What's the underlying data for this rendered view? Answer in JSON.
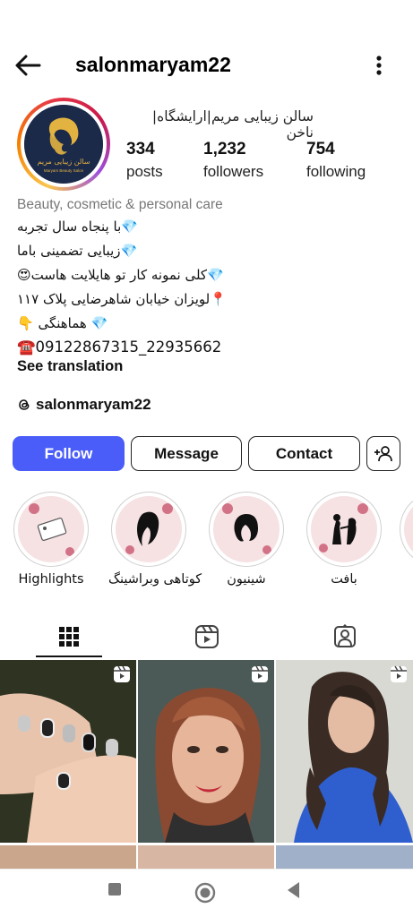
{
  "header": {
    "username": "salonmaryam22",
    "back_icon": "arrow-left-icon",
    "more_icon": "more-vertical-icon"
  },
  "profile": {
    "display_name": "سالن زیبایی مریم|ارایشگاه|ناخن",
    "avatar_text": "سالن زیبایی مریم",
    "avatar_subtext": "Maryam Beauty Salon",
    "stats": [
      {
        "value": "334",
        "label": "posts"
      },
      {
        "value": "1,232",
        "label": "followers"
      },
      {
        "value": "754",
        "label": "following"
      }
    ]
  },
  "bio": {
    "category": "Beauty, cosmetic & personal care",
    "lines": [
      "💎با پنجاه سال تجربه",
      "💎زیبایی تضمینی باما",
      "💎کلی نمونه کار تو هایلایت هاست😍",
      "📍لویزان خیابان شاهرضایی پلاک ۱۱۷",
      "💎 هماهنگی 👇"
    ],
    "phone": "☎️09122867315_22935662",
    "see_translation": "See translation",
    "threads_handle": "salonmaryam22"
  },
  "actions": {
    "follow": "Follow",
    "message": "Message",
    "contact": "Contact"
  },
  "highlights": [
    {
      "label": "Highlights"
    },
    {
      "label": "کوتاهی وبراشینگ"
    },
    {
      "label": "شینیون"
    },
    {
      "label": "بافت"
    }
  ],
  "tabs": [
    {
      "icon": "grid-icon",
      "selected": true
    },
    {
      "icon": "reels-icon",
      "selected": false
    },
    {
      "icon": "tagged-icon",
      "selected": false
    }
  ],
  "colors": {
    "follow_button": "#4a5df9",
    "avatar_background": "#1c2a4a",
    "avatar_gold": "#e3b341",
    "highlight_background": "#f6e1e3"
  }
}
